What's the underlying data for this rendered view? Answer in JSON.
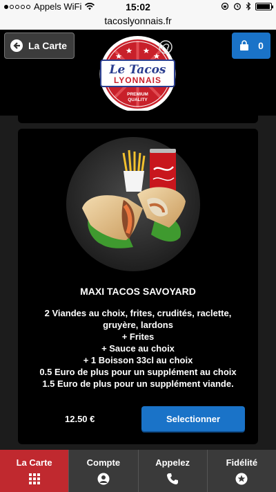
{
  "status_bar": {
    "carrier": "Appels WiFi",
    "time": "15:02"
  },
  "browser": {
    "url": "tacoslyonnais.fr"
  },
  "header": {
    "back_label": "La Carte",
    "cart_count": "0",
    "logo": {
      "line1": "Le Tacos",
      "line2": "LYONNAIS",
      "badge_line1": "PREMIUM",
      "badge_line2": "QUALITY"
    }
  },
  "product": {
    "title": "MAXI TACOS SAVOYARD",
    "description_lines": [
      "2 Viandes au choix, frites, crudités, raclette,",
      "gruyère, lardons",
      "+ Frites",
      "+ Sauce au choix",
      "+ 1 Boisson 33cl au choix",
      "0.5 Euro de plus pour un supplément au choix",
      "1.5 Euro de plus pour un supplément viande."
    ],
    "price": "12.50 €",
    "select_label": "Selectionner"
  },
  "tabs": [
    {
      "label": "La Carte",
      "icon": "grid-icon",
      "active": true
    },
    {
      "label": "Compte",
      "icon": "user-icon",
      "active": false
    },
    {
      "label": "Appelez",
      "icon": "phone-icon",
      "active": false
    },
    {
      "label": "Fidélité",
      "icon": "star-icon",
      "active": false
    }
  ],
  "colors": {
    "accent_blue": "#1a73c8",
    "active_tab_red": "#c0292f",
    "logo_red": "#c8202a"
  }
}
